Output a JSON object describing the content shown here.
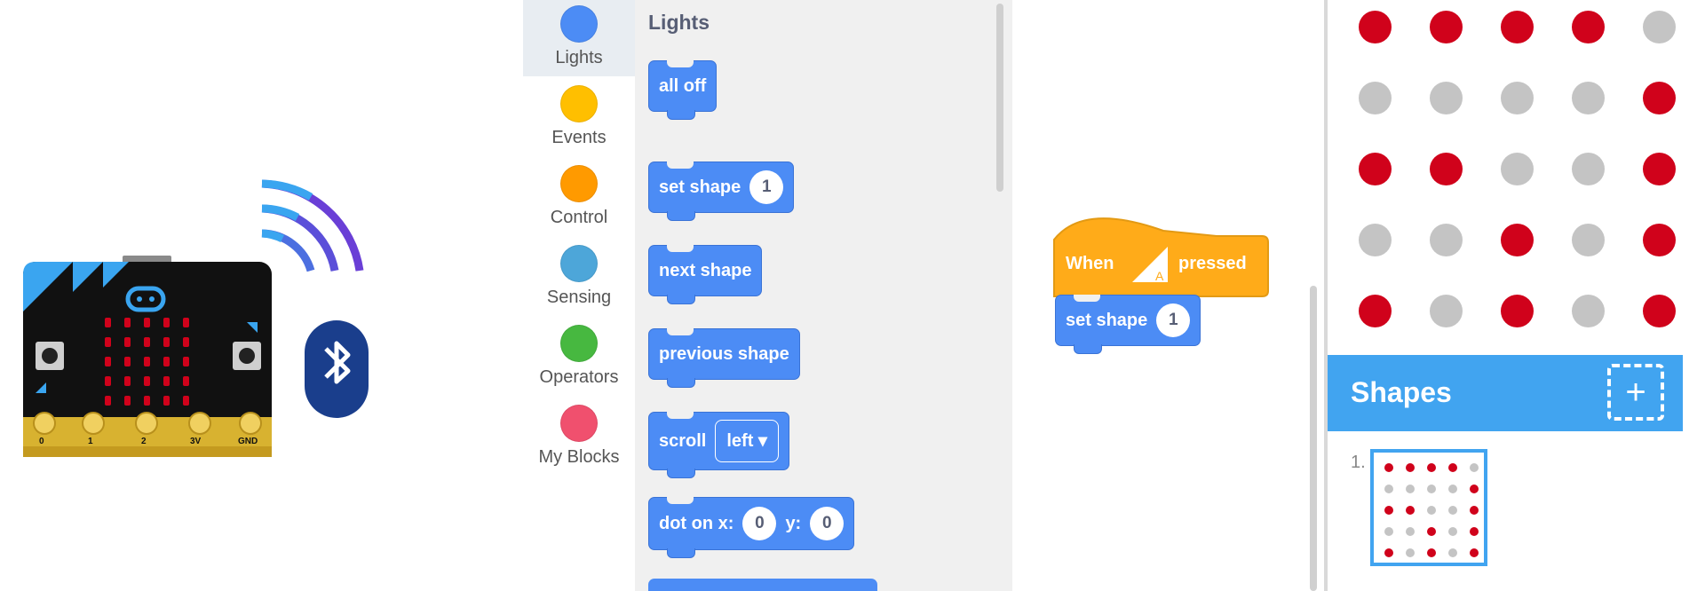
{
  "categories": [
    {
      "label": "Lights",
      "color": "#4c8cf5",
      "selected": true
    },
    {
      "label": "Events",
      "color": "#ffbf00"
    },
    {
      "label": "Control",
      "color": "#ff9a00"
    },
    {
      "label": "Sensing",
      "color": "#4da6d9"
    },
    {
      "label": "Operators",
      "color": "#47b840"
    },
    {
      "label": "My Blocks",
      "color": "#f0506e"
    }
  ],
  "palette": {
    "title": "Lights",
    "blocks": {
      "all_off": "all off",
      "set_shape": "set shape",
      "set_shape_value": "1",
      "next_shape": "next shape",
      "previous_shape": "previous shape",
      "scroll": "scroll",
      "scroll_value": "left",
      "dot_on_x": "dot on x:",
      "dot_x_value": "0",
      "dot_y": "y:",
      "dot_y_value": "0"
    }
  },
  "workspace": {
    "hat_when": "When",
    "hat_button": "A",
    "hat_pressed": "pressed",
    "set_shape": "set shape",
    "set_shape_value": "1"
  },
  "device": {
    "pin_labels": [
      "0",
      "1",
      "2",
      "3V",
      "GND"
    ],
    "button_a": "A",
    "button_b": "B"
  },
  "led_grid": [
    [
      1,
      1,
      1,
      1,
      0
    ],
    [
      0,
      0,
      0,
      0,
      1
    ],
    [
      1,
      1,
      0,
      0,
      1
    ],
    [
      0,
      0,
      1,
      0,
      1
    ],
    [
      1,
      0,
      1,
      0,
      1
    ]
  ],
  "led_colors": {
    "on": "#d0021b",
    "off": "#c4c4c4"
  },
  "shapes_panel": {
    "title": "Shapes",
    "add_icon": "+",
    "items": [
      {
        "number": "1."
      }
    ]
  }
}
